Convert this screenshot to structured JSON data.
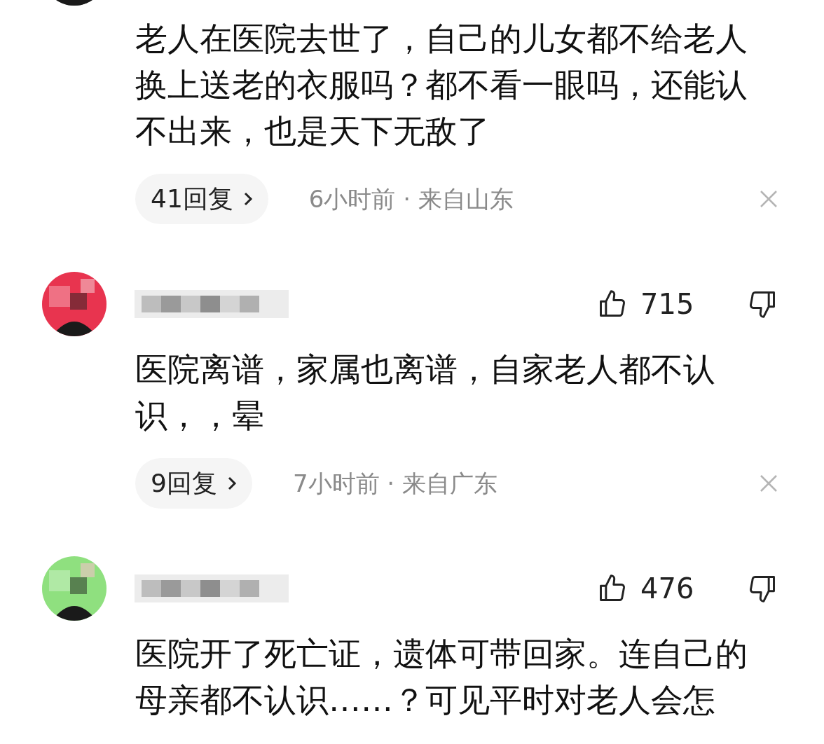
{
  "comments": [
    {
      "text_lines": "老人在医院去世了，自己的儿女都不给老人换上送老的衣服吗？都不看一眼吗，还能认不出来，也是天下无敌了",
      "replies": "41回复",
      "meta": "6小时前 · 来自山东"
    },
    {
      "likes": "715",
      "text_lines": "医院离谱，家属也离谱，自家老人都不认识，，晕",
      "replies": "9回复",
      "meta": "7小时前 · 来自广东"
    },
    {
      "likes": "476",
      "text_lines": "医院开了死亡证，遗体可带回家。连自己的母亲都不认识……？可见平时对老人会怎"
    }
  ]
}
